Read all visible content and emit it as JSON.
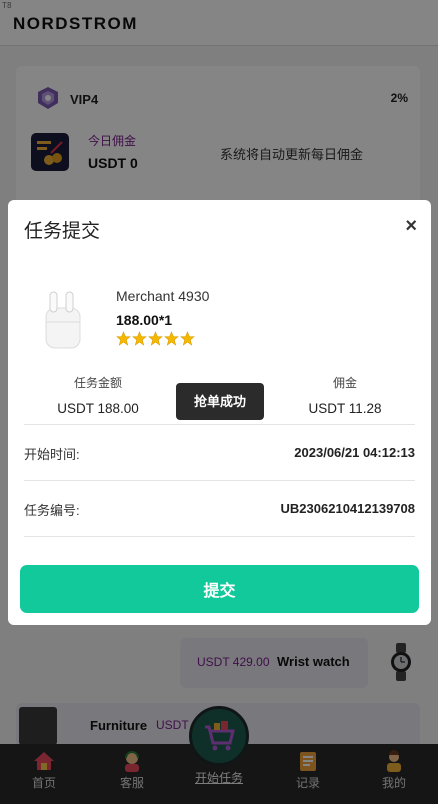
{
  "corner_tag": "T8",
  "header": {
    "brand": "NORDSTROM"
  },
  "vip_card": {
    "level": "VIP4",
    "rate": "2%",
    "today_commission_label": "今日佣金",
    "today_commission_value": "USDT 0",
    "auto_update_text": "系统将自动更新每日佣金"
  },
  "orders": [
    {
      "price": "USDT 429.00",
      "name": "Wrist watch",
      "icon": "wrist-watch-icon"
    },
    {
      "name": "Furniture",
      "price": "USDT"
    }
  ],
  "bottom_nav": {
    "items": [
      {
        "label": "首页",
        "icon": "home-icon"
      },
      {
        "label": "客服",
        "icon": "customer-service-icon"
      },
      {
        "label": "开始任务",
        "icon": "shopping-cart-icon"
      },
      {
        "label": "记录",
        "icon": "records-icon"
      },
      {
        "label": "我的",
        "icon": "profile-icon"
      }
    ]
  },
  "modal": {
    "title": "任务提交",
    "close": "×",
    "merchant": "Merchant 4930",
    "price_qty": "188.00*1",
    "rating": 5,
    "task_amount_label": "任务金额",
    "task_amount_value": "USDT  188.00",
    "commission_label": "佣金",
    "commission_value": "USDT  11.28",
    "start_time_label": "开始时间:",
    "start_time_value": "2023/06/21 04:12:13",
    "task_no_label": "任务编号:",
    "task_no_value": "UB2306210412139708",
    "submit_label": "提交",
    "product_icon": "airpods-icon"
  },
  "toast": {
    "text": "抢单成功"
  },
  "colors": {
    "accent": "#11c99a",
    "purple_text": "#7b1f8f",
    "nav_bg": "#2a2a2a"
  }
}
